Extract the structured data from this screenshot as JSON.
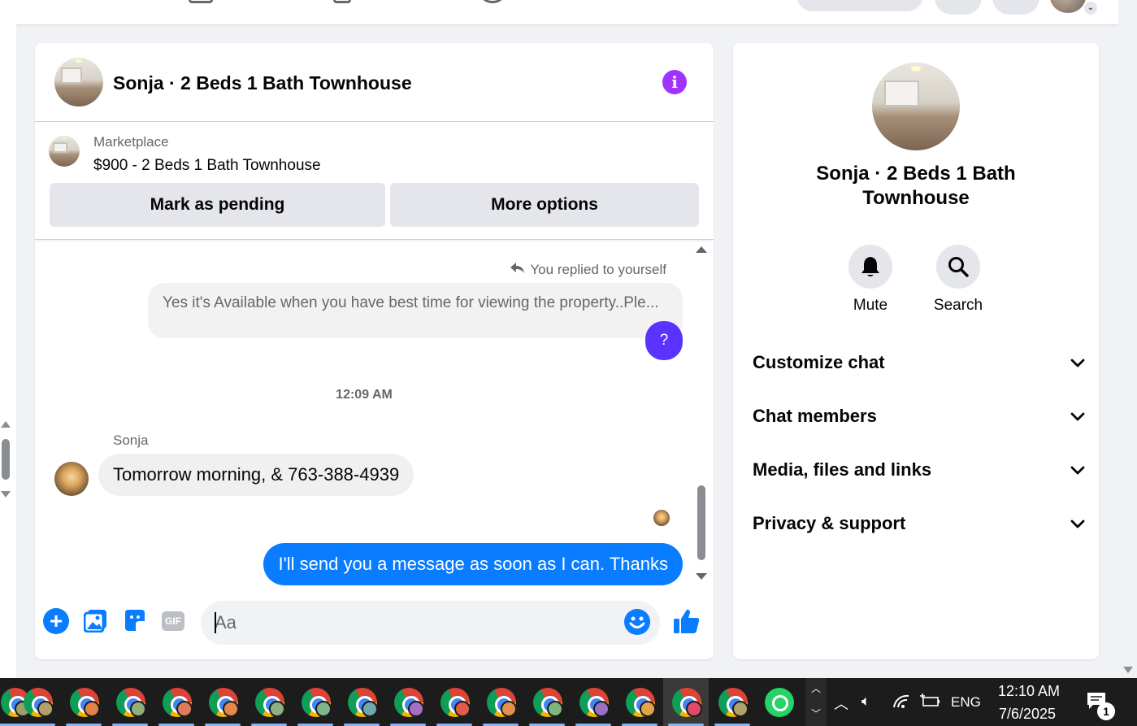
{
  "chat": {
    "title": "Sonja · 2 Beds 1 Bath Townhouse",
    "listing": {
      "source": "Marketplace",
      "name": "$900 - 2 Beds 1 Bath Townhouse",
      "mark_pending_label": "Mark as pending",
      "more_options_label": "More options"
    },
    "messages": {
      "replied_note": "You replied to yourself",
      "quoted_text": "Yes it's Available when you have best time for viewing the property..Ple...",
      "unknown_bubble": "?",
      "timestamp": "12:09 AM",
      "sender_name": "Sonja",
      "incoming_text": "Tomorrow morning, & 763-388-4939",
      "outgoing_text": "I'll send you a message as soon as I can. Thanks"
    },
    "composer": {
      "placeholder": "Aa",
      "gif_label": "GIF"
    }
  },
  "info_panel": {
    "title": "Sonja · 2 Beds 1 Bath Townhouse",
    "actions": [
      {
        "label": "Mute",
        "icon": "bell-icon"
      },
      {
        "label": "Search",
        "icon": "search-icon"
      }
    ],
    "sections": [
      {
        "label": "Customize chat"
      },
      {
        "label": "Chat members"
      },
      {
        "label": "Media, files and links"
      },
      {
        "label": "Privacy & support"
      }
    ]
  },
  "taskbar": {
    "language": "ENG",
    "time": "12:10 AM",
    "date": "7/6/2025",
    "notification_count": "1"
  },
  "colors": {
    "accent": "#0a7cff",
    "info_purple": "#a033ff",
    "unknown_bubble": "#5b33ff"
  }
}
